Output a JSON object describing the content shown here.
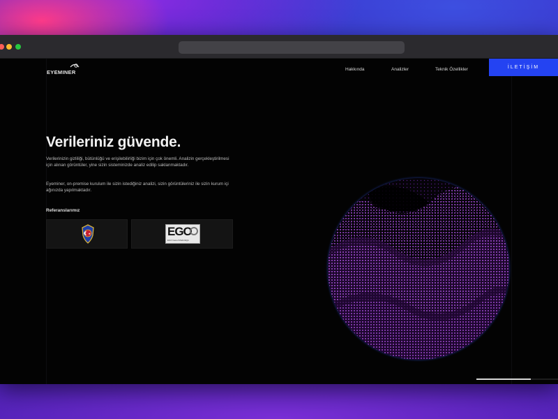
{
  "window": {
    "controls": [
      "close",
      "minimize",
      "maximize"
    ]
  },
  "nav": {
    "logo_text": "EYEMINER",
    "links": [
      "Hakkında",
      "Analizler",
      "Teknik Özellikler"
    ],
    "contact_label": "İLETİŞİM",
    "contact_color": "#2443f2"
  },
  "hero": {
    "title": "Verileriniz güvende.",
    "paragraph1": "Verilerinizin gizliliği, bütünlüğü ve erişilebilirliği bizim için çok önemli. Analizin gerçekleştirilmesi için alınan görüntüler, yine sizin sisteminizde analiz edilip saklanmaktadır.",
    "paragraph2": "Eyeminer, on-premise kurulum ile sizin istediğiniz analizi, sizin görüntüleriniz ile sizin kurum içi ağınızda yapılmaktadır."
  },
  "references": {
    "title": "Referanslarımız",
    "items": [
      {
        "name": "police-emblem"
      },
      {
        "name": "ego",
        "logo_text": "EGO",
        "subtitle": "EGO Genel Müdürlüğü"
      }
    ]
  },
  "visual": {
    "accent": "#a33cf0",
    "description_icon": "particle-wave-sphere"
  }
}
